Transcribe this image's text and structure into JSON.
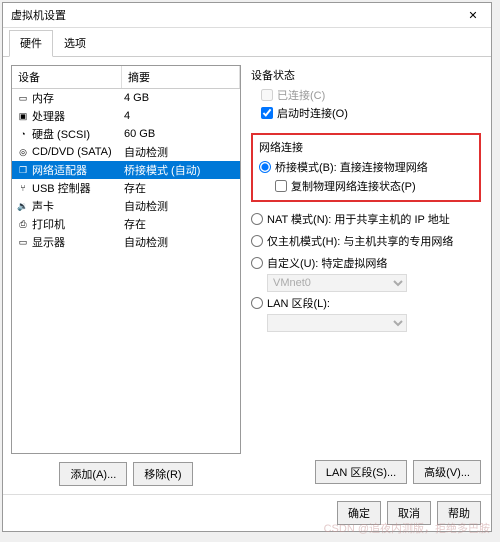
{
  "window": {
    "title": "虚拟机设置",
    "close": "✕"
  },
  "tabs": {
    "hardware": "硬件",
    "options": "选项"
  },
  "list": {
    "header_device": "设备",
    "header_summary": "摘要",
    "items": [
      {
        "icon": "▭",
        "label": "内存",
        "summary": "4 GB"
      },
      {
        "icon": "▣",
        "label": "处理器",
        "summary": "4"
      },
      {
        "icon": "◔",
        "label": "硬盘 (SCSI)",
        "summary": "60 GB"
      },
      {
        "icon": "◎",
        "label": "CD/DVD (SATA)",
        "summary": "自动检测"
      },
      {
        "icon": "❐",
        "label": "网络适配器",
        "summary": "桥接模式 (自动)"
      },
      {
        "icon": "⑂",
        "label": "USB 控制器",
        "summary": "存在"
      },
      {
        "icon": "🔉",
        "label": "声卡",
        "summary": "自动检测"
      },
      {
        "icon": "⎙",
        "label": "打印机",
        "summary": "存在"
      },
      {
        "icon": "▭",
        "label": "显示器",
        "summary": "自动检测"
      }
    ]
  },
  "left_buttons": {
    "add": "添加(A)...",
    "remove": "移除(R)"
  },
  "status": {
    "title": "设备状态",
    "connected": "已连接(C)",
    "power_on_connect": "启动时连接(O)"
  },
  "network": {
    "title": "网络连接",
    "bridged": "桥接模式(B): 直接连接物理网络",
    "replicate": "复制物理网络连接状态(P)",
    "nat": "NAT 模式(N): 用于共享主机的 IP 地址",
    "host_only": "仅主机模式(H): 与主机共享的专用网络",
    "custom": "自定义(U): 特定虚拟网络",
    "custom_select": "VMnet0",
    "lan_segment": "LAN 区段(L):"
  },
  "right_buttons": {
    "lan": "LAN 区段(S)...",
    "advanced": "高级(V)..."
  },
  "footer": {
    "ok": "确定",
    "cancel": "取消",
    "help": "帮助"
  },
  "watermark": "CSDN @追夜内测版，拒绝多巴胺"
}
